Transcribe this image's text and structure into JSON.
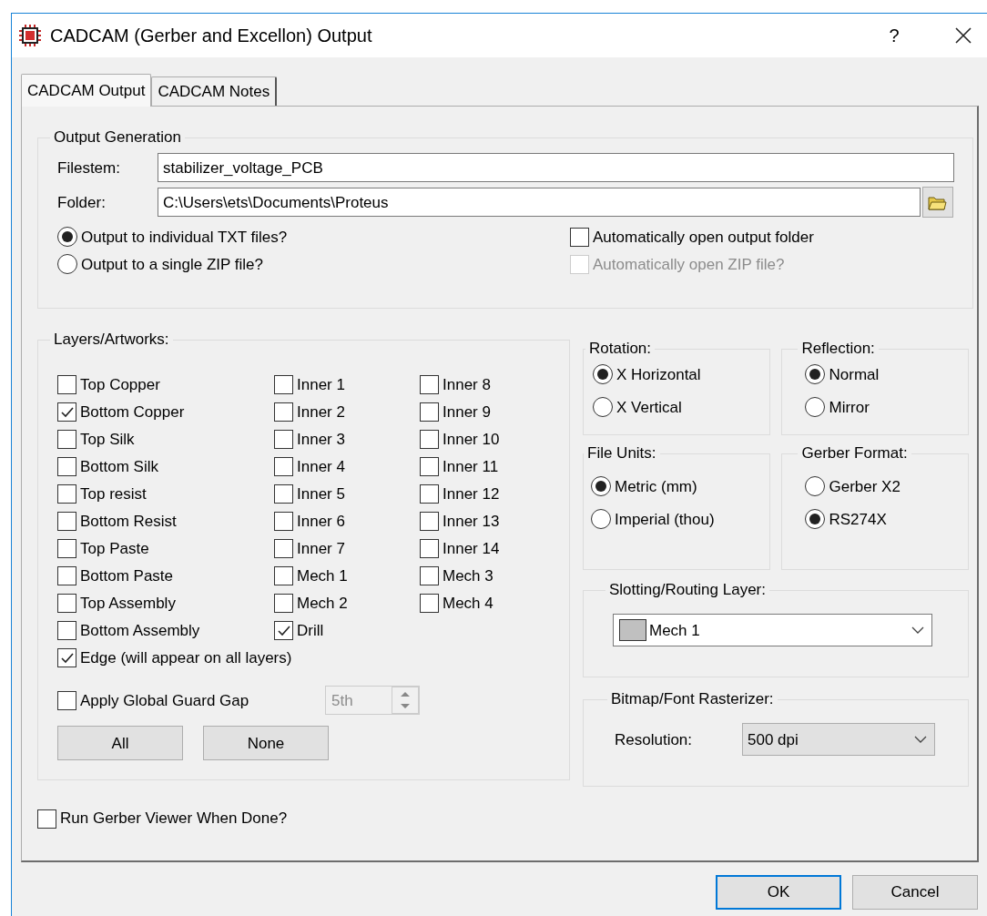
{
  "window": {
    "title": "CADCAM (Gerber and Excellon) Output",
    "help": "?"
  },
  "tabs": [
    {
      "label": "CADCAM Output",
      "selected": true
    },
    {
      "label": "CADCAM Notes",
      "selected": false
    }
  ],
  "output_generation": {
    "title": "Output Generation",
    "filestem": {
      "label": "Filestem:",
      "value": "stabilizer_voltage_PCB"
    },
    "folder": {
      "label": "Folder:",
      "value": "C:\\Users\\ets\\Documents\\Proteus"
    },
    "output_mode": [
      {
        "label": "Output to individual TXT files?",
        "selected": true
      },
      {
        "label": "Output to a single ZIP file?",
        "selected": false
      }
    ],
    "options": [
      {
        "label": "Automatically open output folder",
        "checked": false,
        "disabled": false
      },
      {
        "label": "Automatically open ZIP file?",
        "checked": false,
        "disabled": true
      }
    ]
  },
  "layers": {
    "title": "Layers/Artworks:",
    "columns": [
      [
        {
          "label": "Top Copper",
          "checked": false
        },
        {
          "label": "Bottom Copper",
          "checked": true
        },
        {
          "label": "Top Silk",
          "checked": false
        },
        {
          "label": "Bottom Silk",
          "checked": false
        },
        {
          "label": "Top resist",
          "checked": false
        },
        {
          "label": "Bottom Resist",
          "checked": false
        },
        {
          "label": "Top Paste",
          "checked": false
        },
        {
          "label": "Bottom Paste",
          "checked": false
        },
        {
          "label": "Top Assembly",
          "checked": false
        },
        {
          "label": "Bottom Assembly",
          "checked": false
        }
      ],
      [
        {
          "label": "Inner 1",
          "checked": false
        },
        {
          "label": "Inner 2",
          "checked": false
        },
        {
          "label": "Inner 3",
          "checked": false
        },
        {
          "label": "Inner 4",
          "checked": false
        },
        {
          "label": "Inner 5",
          "checked": false
        },
        {
          "label": "Inner 6",
          "checked": false
        },
        {
          "label": "Inner 7",
          "checked": false
        },
        {
          "label": "Mech 1",
          "checked": false
        },
        {
          "label": "Mech 2",
          "checked": false
        },
        {
          "label": "Drill",
          "checked": true
        }
      ],
      [
        {
          "label": "Inner 8",
          "checked": false
        },
        {
          "label": "Inner 9",
          "checked": false
        },
        {
          "label": "Inner 10",
          "checked": false
        },
        {
          "label": "Inner 11",
          "checked": false
        },
        {
          "label": "Inner 12",
          "checked": false
        },
        {
          "label": "Inner 13",
          "checked": false
        },
        {
          "label": "Inner 14",
          "checked": false
        },
        {
          "label": "Mech 3",
          "checked": false
        },
        {
          "label": "Mech 4",
          "checked": false
        }
      ]
    ],
    "edge": {
      "label": "Edge (will appear on all layers)",
      "checked": true
    },
    "guard_gap": {
      "label": "Apply Global Guard Gap",
      "checked": false,
      "spin": {
        "value": "5th",
        "disabled": true
      }
    },
    "buttons": [
      "All",
      "None"
    ]
  },
  "rotation": {
    "title": "Rotation:",
    "options": [
      {
        "label": "X Horizontal",
        "selected": true
      },
      {
        "label": "X Vertical",
        "selected": false
      }
    ]
  },
  "reflection": {
    "title": "Reflection:",
    "options": [
      {
        "label": "Normal",
        "selected": true
      },
      {
        "label": "Mirror",
        "selected": false
      }
    ]
  },
  "file_units": {
    "title": "File Units:",
    "options": [
      {
        "label": "Metric (mm)",
        "selected": true
      },
      {
        "label": "Imperial (thou)",
        "selected": false
      }
    ]
  },
  "gerber_format": {
    "title": "Gerber Format:",
    "options": [
      {
        "label": "Gerber X2",
        "selected": false
      },
      {
        "label": "RS274X",
        "selected": true
      }
    ]
  },
  "slotting": {
    "title": "Slotting/Routing Layer:",
    "value": "Mech 1"
  },
  "rasterizer": {
    "title": "Bitmap/Font Rasterizer:",
    "label": "Resolution:",
    "value": "500 dpi"
  },
  "run_viewer": {
    "label": "Run Gerber Viewer When Done?",
    "checked": false
  },
  "buttons": [
    {
      "label": "OK",
      "default": true
    },
    {
      "label": "Cancel",
      "default": false
    }
  ]
}
